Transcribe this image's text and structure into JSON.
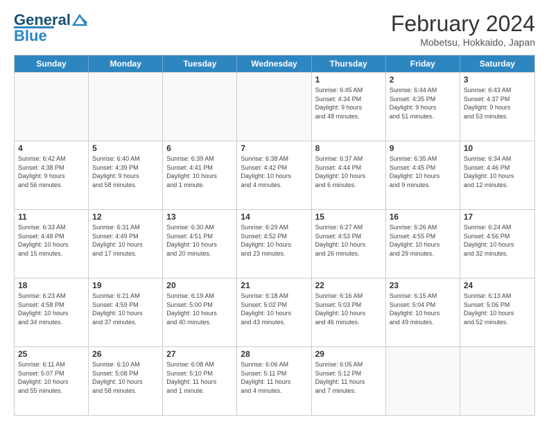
{
  "logo": {
    "line1": "General",
    "line2": "Blue"
  },
  "title": "February 2024",
  "subtitle": "Mobetsu, Hokkaido, Japan",
  "weekdays": [
    "Sunday",
    "Monday",
    "Tuesday",
    "Wednesday",
    "Thursday",
    "Friday",
    "Saturday"
  ],
  "rows": [
    [
      {
        "day": "",
        "info": ""
      },
      {
        "day": "",
        "info": ""
      },
      {
        "day": "",
        "info": ""
      },
      {
        "day": "",
        "info": ""
      },
      {
        "day": "1",
        "info": "Sunrise: 6:45 AM\nSunset: 4:34 PM\nDaylight: 9 hours\nand 48 minutes."
      },
      {
        "day": "2",
        "info": "Sunrise: 6:44 AM\nSunset: 4:35 PM\nDaylight: 9 hours\nand 51 minutes."
      },
      {
        "day": "3",
        "info": "Sunrise: 6:43 AM\nSunset: 4:37 PM\nDaylight: 9 hours\nand 53 minutes."
      }
    ],
    [
      {
        "day": "4",
        "info": "Sunrise: 6:42 AM\nSunset: 4:38 PM\nDaylight: 9 hours\nand 56 minutes."
      },
      {
        "day": "5",
        "info": "Sunrise: 6:40 AM\nSunset: 4:39 PM\nDaylight: 9 hours\nand 58 minutes."
      },
      {
        "day": "6",
        "info": "Sunrise: 6:39 AM\nSunset: 4:41 PM\nDaylight: 10 hours\nand 1 minute."
      },
      {
        "day": "7",
        "info": "Sunrise: 6:38 AM\nSunset: 4:42 PM\nDaylight: 10 hours\nand 4 minutes."
      },
      {
        "day": "8",
        "info": "Sunrise: 6:37 AM\nSunset: 4:44 PM\nDaylight: 10 hours\nand 6 minutes."
      },
      {
        "day": "9",
        "info": "Sunrise: 6:35 AM\nSunset: 4:45 PM\nDaylight: 10 hours\nand 9 minutes."
      },
      {
        "day": "10",
        "info": "Sunrise: 6:34 AM\nSunset: 4:46 PM\nDaylight: 10 hours\nand 12 minutes."
      }
    ],
    [
      {
        "day": "11",
        "info": "Sunrise: 6:33 AM\nSunset: 4:48 PM\nDaylight: 10 hours\nand 15 minutes."
      },
      {
        "day": "12",
        "info": "Sunrise: 6:31 AM\nSunset: 4:49 PM\nDaylight: 10 hours\nand 17 minutes."
      },
      {
        "day": "13",
        "info": "Sunrise: 6:30 AM\nSunset: 4:51 PM\nDaylight: 10 hours\nand 20 minutes."
      },
      {
        "day": "14",
        "info": "Sunrise: 6:29 AM\nSunset: 4:52 PM\nDaylight: 10 hours\nand 23 minutes."
      },
      {
        "day": "15",
        "info": "Sunrise: 6:27 AM\nSunset: 4:53 PM\nDaylight: 10 hours\nand 26 minutes."
      },
      {
        "day": "16",
        "info": "Sunrise: 6:26 AM\nSunset: 4:55 PM\nDaylight: 10 hours\nand 29 minutes."
      },
      {
        "day": "17",
        "info": "Sunrise: 6:24 AM\nSunset: 4:56 PM\nDaylight: 10 hours\nand 32 minutes."
      }
    ],
    [
      {
        "day": "18",
        "info": "Sunrise: 6:23 AM\nSunset: 4:58 PM\nDaylight: 10 hours\nand 34 minutes."
      },
      {
        "day": "19",
        "info": "Sunrise: 6:21 AM\nSunset: 4:59 PM\nDaylight: 10 hours\nand 37 minutes."
      },
      {
        "day": "20",
        "info": "Sunrise: 6:19 AM\nSunset: 5:00 PM\nDaylight: 10 hours\nand 40 minutes."
      },
      {
        "day": "21",
        "info": "Sunrise: 6:18 AM\nSunset: 5:02 PM\nDaylight: 10 hours\nand 43 minutes."
      },
      {
        "day": "22",
        "info": "Sunrise: 6:16 AM\nSunset: 5:03 PM\nDaylight: 10 hours\nand 46 minutes."
      },
      {
        "day": "23",
        "info": "Sunrise: 6:15 AM\nSunset: 5:04 PM\nDaylight: 10 hours\nand 49 minutes."
      },
      {
        "day": "24",
        "info": "Sunrise: 6:13 AM\nSunset: 5:06 PM\nDaylight: 10 hours\nand 52 minutes."
      }
    ],
    [
      {
        "day": "25",
        "info": "Sunrise: 6:11 AM\nSunset: 5:07 PM\nDaylight: 10 hours\nand 55 minutes."
      },
      {
        "day": "26",
        "info": "Sunrise: 6:10 AM\nSunset: 5:08 PM\nDaylight: 10 hours\nand 58 minutes."
      },
      {
        "day": "27",
        "info": "Sunrise: 6:08 AM\nSunset: 5:10 PM\nDaylight: 11 hours\nand 1 minute."
      },
      {
        "day": "28",
        "info": "Sunrise: 6:06 AM\nSunset: 5:11 PM\nDaylight: 11 hours\nand 4 minutes."
      },
      {
        "day": "29",
        "info": "Sunrise: 6:05 AM\nSunset: 5:12 PM\nDaylight: 11 hours\nand 7 minutes."
      },
      {
        "day": "",
        "info": ""
      },
      {
        "day": "",
        "info": ""
      }
    ]
  ]
}
